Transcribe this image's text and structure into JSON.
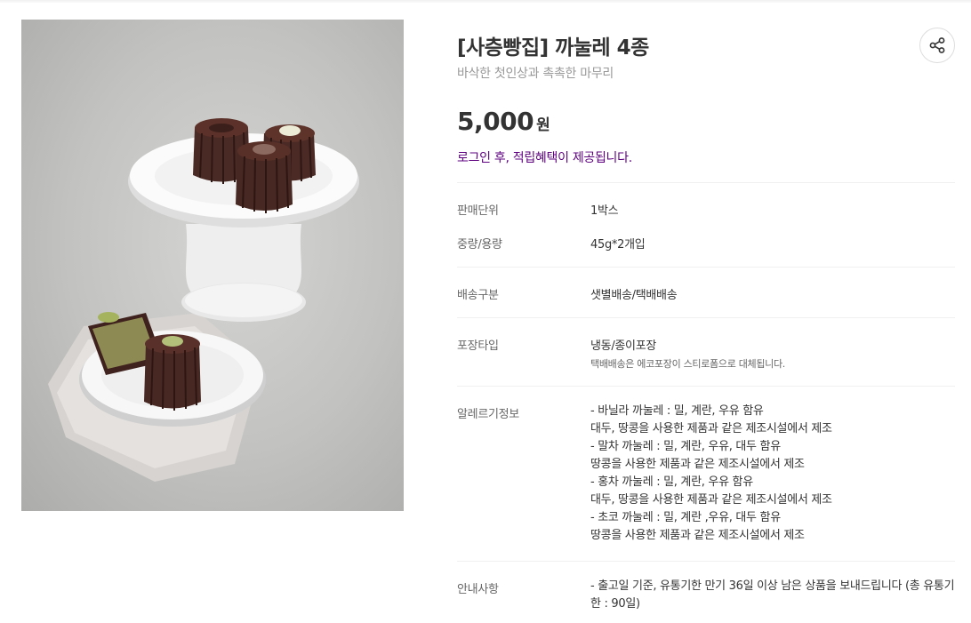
{
  "product": {
    "title": "[사층빵집] 까눌레 4종",
    "subtitle": "바삭한 첫인상과 촉촉한 마무리",
    "price": "5,000",
    "price_unit": "원",
    "login_notice": "로그인 후, 적립혜택이 제공됩니다.",
    "share_icon": "share-icon",
    "image_alt": "canele-product-photo"
  },
  "details": {
    "unit": {
      "label": "판매단위",
      "value": "1박스"
    },
    "weight": {
      "label": "중량/용량",
      "value": "45g*2개입"
    },
    "delivery": {
      "label": "배송구분",
      "value": "샛별배송/택배배송"
    },
    "packaging": {
      "label": "포장타입",
      "value": "냉동/종이포장",
      "note": "택배배송은 에코포장이 스티로폼으로 대체됩니다."
    },
    "allergy": {
      "label": "알레르기정보",
      "lines": [
        "- 바닐라 까눌레 : 밀, 계란, 우유 함유",
        "대두, 땅콩을 사용한 제품과 같은 제조시설에서 제조",
        "- 말차 까눌레 : 밀, 계란, 우유, 대두 함유",
        "땅콩을 사용한 제품과 같은 제조시설에서 제조",
        "- 홍차 까눌레 : 밀, 계란, 우유 함유",
        "대두, 땅콩을 사용한 제품과 같은 제조시설에서 제조",
        "- 초코 까눌레 : 밀, 계란 ,우유, 대두 함유",
        "땅콩을 사용한 제품과 같은 제조시설에서 제조"
      ]
    },
    "guide": {
      "label": "안내사항",
      "value": "- 출고일 기준, 유통기한 만기 36일 이상 남은 상품을 보내드립니다 (총 유통기한 : 90일)"
    }
  },
  "colors": {
    "accent": "#5f0080",
    "text": "#333333",
    "muted": "#999999",
    "divider": "#f0f0f0"
  }
}
